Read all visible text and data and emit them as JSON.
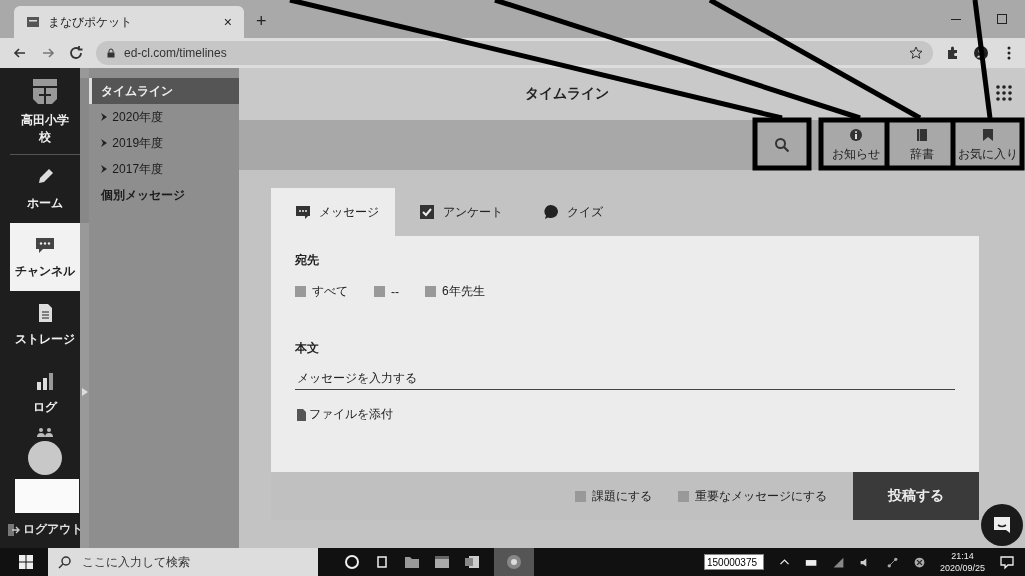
{
  "browser": {
    "tab_title": "まなびポケット",
    "tab_close": "×",
    "new_tab": "+",
    "address": "ed-cl.com/timelines"
  },
  "nav": {
    "school": "高田小学校",
    "items": [
      {
        "label": "ホーム",
        "selected": false
      },
      {
        "label": "チャンネル",
        "selected": true
      },
      {
        "label": "ストレージ",
        "selected": false
      },
      {
        "label": "ログ",
        "selected": false
      }
    ],
    "logout": "ログアウト"
  },
  "sidebar": {
    "items": [
      {
        "label": "タイムライン",
        "kind": "heading",
        "selected": true
      },
      {
        "label": "2020年度",
        "kind": "folder",
        "selected": false
      },
      {
        "label": "2019年度",
        "kind": "folder",
        "selected": false
      },
      {
        "label": "2017年度",
        "kind": "folder",
        "selected": false
      },
      {
        "label": "個別メッセージ",
        "kind": "plain",
        "selected": false
      }
    ]
  },
  "header": {
    "title": "タイムライン"
  },
  "toolbar": {
    "buttons": [
      {
        "label": "お知らせ"
      },
      {
        "label": "辞書"
      },
      {
        "label": "お気に入り"
      }
    ]
  },
  "composer": {
    "tabs": [
      {
        "label": "メッセージ",
        "selected": true
      },
      {
        "label": "アンケート",
        "selected": false
      },
      {
        "label": "クイズ",
        "selected": false
      }
    ],
    "recipients_label": "宛先",
    "recipients": [
      {
        "label": "すべて",
        "checked": false
      },
      {
        "label": "--",
        "checked": false
      },
      {
        "label": "6年先生",
        "checked": false
      }
    ],
    "body_label": "本文",
    "body_placeholder": "メッセージを入力する",
    "attach": "ファイルを添付",
    "options": [
      {
        "label": "課題にする",
        "checked": false
      },
      {
        "label": "重要なメッセージにする",
        "checked": false
      }
    ],
    "submit": "投稿する"
  },
  "taskbar": {
    "search_placeholder": "ここに入力して検索",
    "input_value": "150000375",
    "time": "21:14",
    "date": "2020/09/25"
  }
}
